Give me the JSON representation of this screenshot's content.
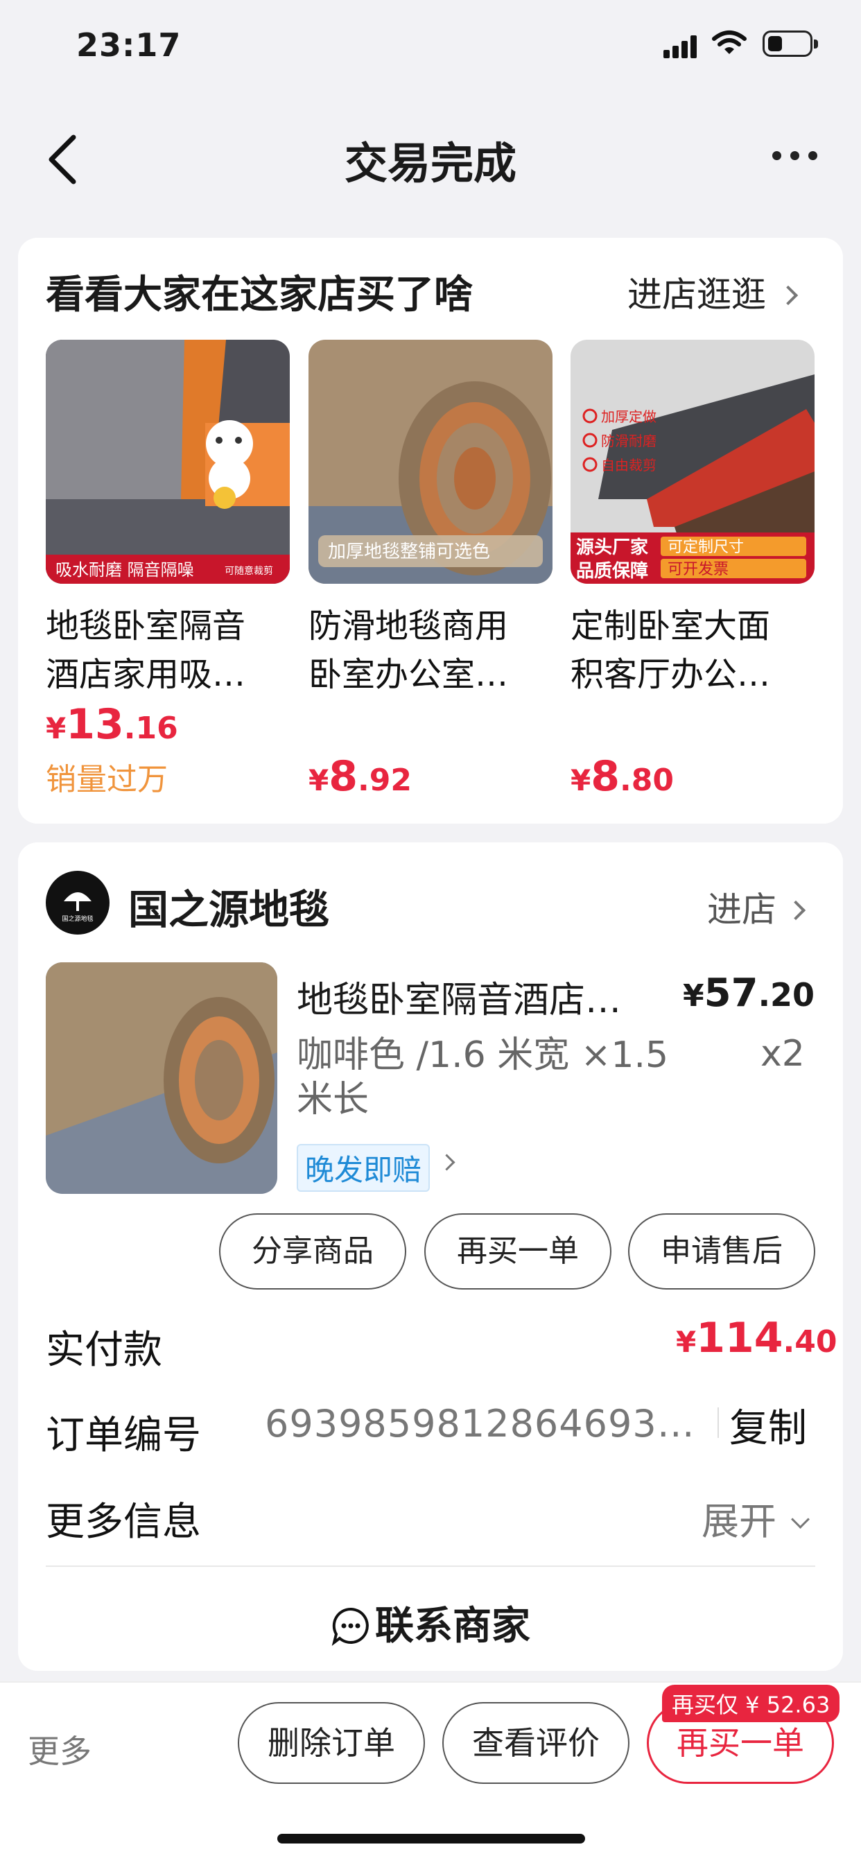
{
  "status": {
    "time": "23:17"
  },
  "nav": {
    "title": "交易完成"
  },
  "recommend": {
    "title": "看看大家在这家店买了啥",
    "link": "进店逛逛",
    "items": [
      {
        "name": "地毯卧室隔音\n酒店家用吸…",
        "sym": "¥",
        "int": "13",
        "dec": ".16",
        "sales": "销量过万",
        "banner1": "吸水耐磨 隔音隔噪",
        "banner2": "可随意裁剪"
      },
      {
        "name": "防滑地毯商用\n卧室办公室…",
        "sym": "¥",
        "int": "8",
        "dec": ".92",
        "banner1": "加厚地毯整铺可选色"
      },
      {
        "name": "定制卧室大面\n积客厅办公…",
        "sym": "¥",
        "int": "8",
        "dec": ".80",
        "banner1": "源头厂家",
        "banner2": "品质保障",
        "banner3": "可定制尺寸",
        "banner4": "可开发票",
        "checks": [
          "加厚定做",
          "防滑耐磨",
          "自由裁剪"
        ]
      }
    ]
  },
  "order": {
    "shop_name": "国之源地毯",
    "shop_logo_text": "国之源地毯",
    "shop_link": "进店",
    "item": {
      "name": "地毯卧室隔音酒店…",
      "sym": "¥",
      "int": "57",
      "dec": ".20",
      "spec": "咖啡色 /1.6 米宽 ×1.5 米长",
      "qty": "x2",
      "tag": "晚发即赔"
    },
    "actions": [
      "分享商品",
      "再买一单",
      "申请售后"
    ],
    "paid_label": "实付款",
    "paid": {
      "sym": "¥",
      "int": "114",
      "dec": ".40"
    },
    "order_no_label": "订单编号",
    "order_no": "6939859812864693…",
    "copy": "复制",
    "more_info_label": "更多信息",
    "expand": "展开",
    "contact": "联系商家"
  },
  "bottom": {
    "more": "更多",
    "delete": "删除订单",
    "review": "查看评价",
    "rebuy": "再买一单",
    "rebuy_badge": "再买仅 ¥ 52.63"
  },
  "colors": {
    "accent": "#e8253f",
    "sales": "#f0943c",
    "tag_blue": "#1e8ad6"
  }
}
